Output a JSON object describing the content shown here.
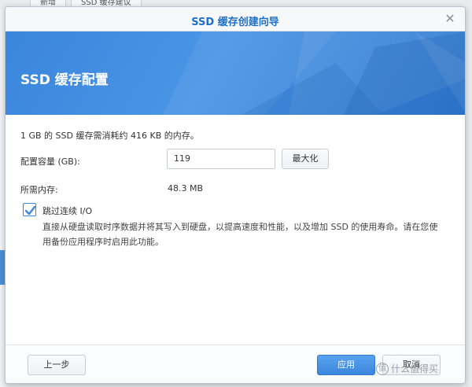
{
  "background": {
    "tabs": [
      "新增",
      "SSD 缓存建议"
    ]
  },
  "dialog": {
    "title": "SSD 缓存创建向导",
    "close_icon": "close-icon",
    "banner_title": "SSD 缓存配置",
    "info_text": "1 GB 的 SSD 缓存需消耗约 416 KB 的内存。",
    "capacity_label": "配置容量 (GB):",
    "capacity_value": "119",
    "maximize_label": "最大化",
    "memory_label": "所需内存:",
    "memory_value": "48.3 MB",
    "skip_io_checked": true,
    "skip_io_label": "跳过连续 I/O",
    "skip_io_desc": "直接从硬盘读取时序数据并将其写入到硬盘，以提高速度和性能，以及增加 SSD 的使用寿命。请在您使用备份应用程序时启用此功能。",
    "back_label": "上一步",
    "apply_label": "应用",
    "cancel_label": "取消"
  },
  "watermark": {
    "icon_text": "值",
    "text": "什么值得买"
  },
  "colors": {
    "accent": "#3a86dc",
    "title": "#1e6fc9"
  }
}
